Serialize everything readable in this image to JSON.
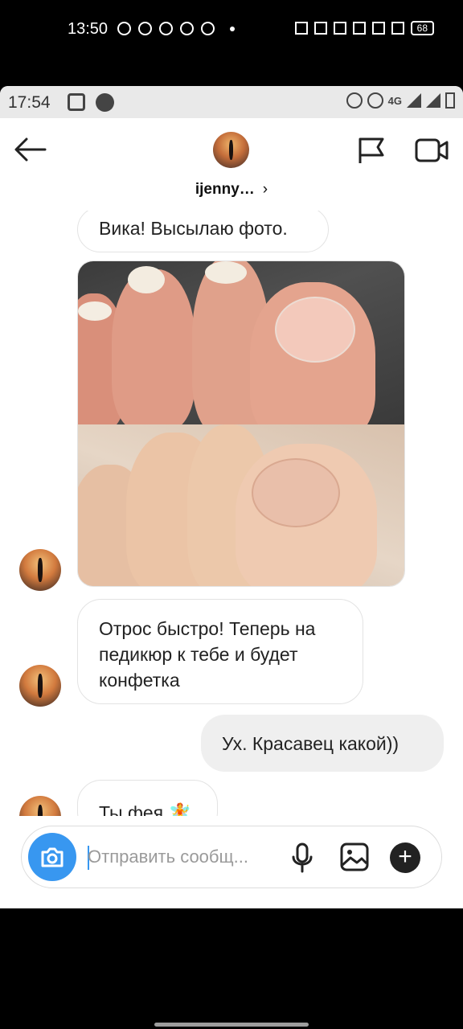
{
  "outer_status": {
    "time": "13:50",
    "battery": "68"
  },
  "status": {
    "time": "17:54",
    "network": "4G"
  },
  "header": {
    "username": "ijenny…",
    "chevron": "›"
  },
  "messages": [
    {
      "side": "in",
      "text": "Вика! Высылаю фото."
    },
    {
      "side": "in",
      "type": "photo"
    },
    {
      "side": "in",
      "text": "Отрос быстро! Теперь на педикюр к тебе и будет конфетка"
    },
    {
      "side": "out",
      "text": "Ух. Красавец какой))"
    },
    {
      "side": "in",
      "text": "Ты фея 🧚"
    }
  ],
  "composer": {
    "placeholder": "Отправить сообщ..."
  },
  "colors": {
    "accent": "#3897f0",
    "outgoing_bubble": "#efefef"
  }
}
